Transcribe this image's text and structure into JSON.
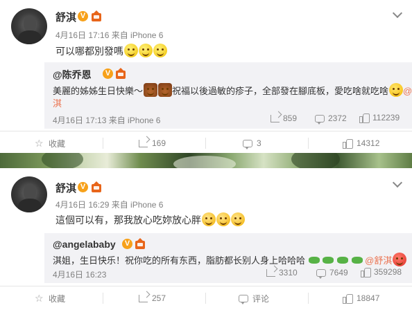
{
  "post1": {
    "username": "舒淇",
    "vip_badge": "V",
    "meta": "4月16日 17:16 来自 iPhone 6",
    "text": "可以哪都別發嗎",
    "repost": {
      "username": "@陈乔恩",
      "text_line1": "美麗的姊姊生日快樂～",
      "text_line1b": "祝福以後過敏的疹子，全部發在腳底板，愛吃啥就吃啥",
      "mention": "@舒",
      "text_line2": "淇",
      "time": "4月16日 17:13 来自 iPhone 6",
      "shares": "859",
      "comments": "2372",
      "likes": "112239"
    },
    "actions": {
      "favorite_label": "收藏",
      "shares": "169",
      "comments": "3",
      "likes": "14312"
    }
  },
  "post2": {
    "username": "舒淇",
    "vip_badge": "V",
    "meta": "4月16日 16:29 来自 iPhone 6",
    "text": "這個可以有，那我放心吃妳放心胖",
    "repost": {
      "username": "@angelababy",
      "text_line1": "淇姐，生日快乐！祝你吃的所有东西，脂肪都长别人身上哈哈哈",
      "mention": "@舒淇",
      "time": "4月16日 16:23",
      "shares": "3310",
      "comments": "7649",
      "likes": "359298"
    },
    "actions": {
      "favorite_label": "收藏",
      "shares": "257",
      "comments_label": "评论",
      "likes": "18847"
    }
  },
  "colors": {
    "accent": "#eb7350",
    "vip": "#f7a11a",
    "muted": "#808080"
  }
}
